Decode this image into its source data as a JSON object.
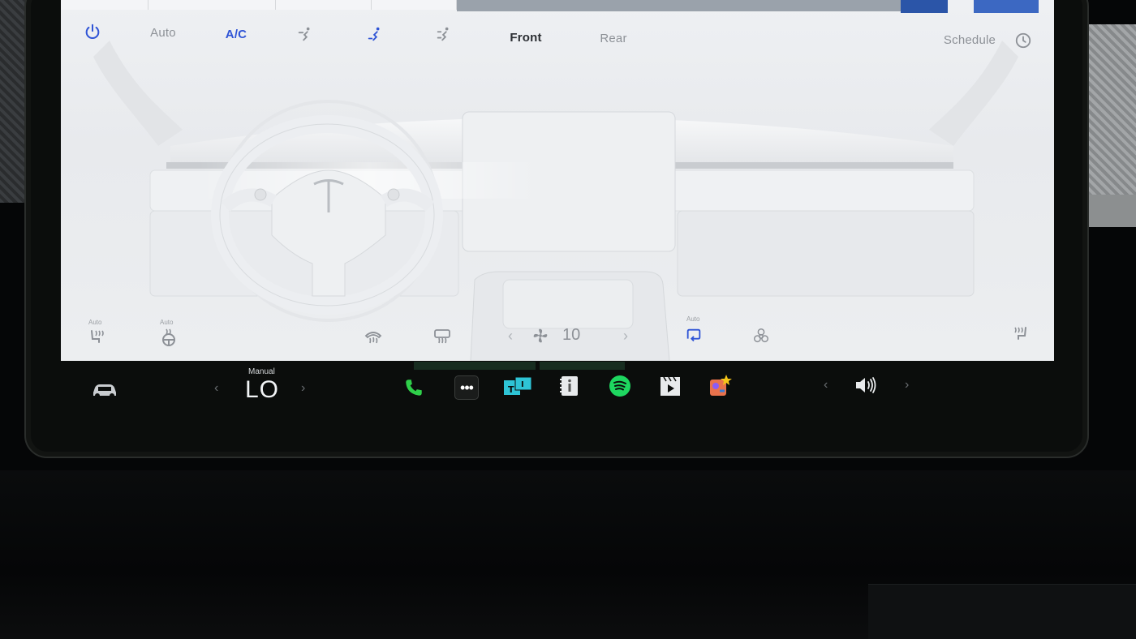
{
  "climate_top": {
    "power_icon": "power-icon",
    "auto_label": "Auto",
    "ac_label": "A/C",
    "front_label": "Front",
    "rear_label": "Rear",
    "schedule_label": "Schedule",
    "airflow_icons": [
      "airflow-face-icon",
      "airflow-feet-icon",
      "airflow-defrost-icon"
    ]
  },
  "climate_bottom": {
    "seat_heat_left_auto": "Auto",
    "steering_heat_auto": "Auto",
    "recirc_auto": "Auto",
    "fan_speed": "10"
  },
  "dock": {
    "temp_mode": "Manual",
    "temp_value": "LO",
    "apps": [
      "phone-icon",
      "more-icon",
      "toybox-icon",
      "manual-icon",
      "spotify-icon",
      "theater-icon",
      "arcade-icon"
    ]
  },
  "colors": {
    "accent_blue": "#2f54d6",
    "screen_bg": "#eceef0",
    "dock_bg": "#0b0d0c",
    "phone_green": "#2fcf4a",
    "spotify_green": "#1ed760"
  }
}
